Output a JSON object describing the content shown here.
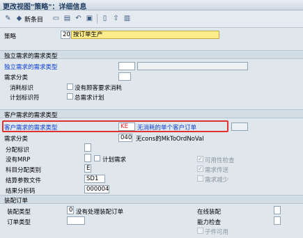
{
  "window": {
    "title": "更改视图\"策略\"：详细信息"
  },
  "toolbar": {
    "new_entry_label": "新条目",
    "icons": [
      "pencil-check-icon",
      "copy-icon",
      "delete-icon",
      "undo-icon",
      "save-icon",
      "document-icon",
      "export-icon",
      "delete-row-icon"
    ]
  },
  "strategy": {
    "label": "策略",
    "code": "20",
    "description": "按订单生产"
  },
  "independent_group": {
    "title": "独立需求的需求类型",
    "req_type_label": "独立需求的需求类型",
    "req_class_label": "需求分类",
    "consumption_label": "消耗标识",
    "consumption_checkbox_label": "没有顾客要求消耗",
    "planning_ind_label": "计划标识符",
    "planning_ind_checkbox_label": "总需求计划"
  },
  "customer_group": {
    "title": "客户需求的需求类型",
    "req_type_label": "客户需求的需求类型",
    "req_type_value": "KE",
    "req_type_desc": "无消耗的单个客户订单",
    "req_class_label": "需求分类",
    "req_class_value": "040",
    "req_class_desc": "无cons的MkToOrdNoVal",
    "alloc_ind_label": "分配标识",
    "no_mrp_label": "没有MRP",
    "plan_req_label": "计划需求",
    "acct_assign_label": "科目分配类别",
    "acct_assign_value": "E",
    "settle_profile_label": "结算参数文件",
    "settle_profile_value": "SD1",
    "result_analysis_label": "结果分析码",
    "result_analysis_value": "000004",
    "availability_check_label": "可用性检查",
    "req_transfer_label": "需求传送",
    "req_reduction_label": "需求减少"
  },
  "assembly_group": {
    "title": "装配订单",
    "assembly_type_label": "装配类型",
    "assembly_type_value": "0",
    "assembly_type_desc": "没有处理装配订单",
    "order_type_label": "订单类型",
    "online_assembly_label": "在线装配",
    "capacity_check_label": "能力检查",
    "components_available_label": "子件可用"
  }
}
